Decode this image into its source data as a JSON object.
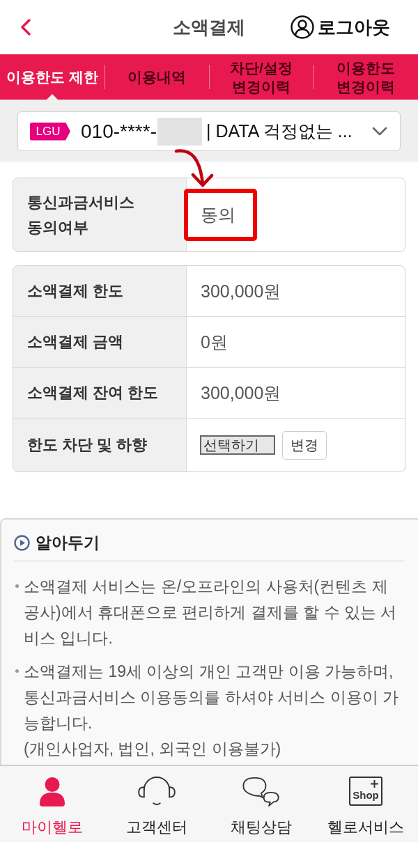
{
  "header": {
    "title": "소액결제",
    "logout": "로그아웃"
  },
  "tabs": [
    {
      "label": "이용한도 제한",
      "selected": true
    },
    {
      "label": "이용내역",
      "selected": false
    },
    {
      "label": "차단/설정 변경이력",
      "selected": false
    },
    {
      "label": "이용한도 변경이력",
      "selected": false
    }
  ],
  "account": {
    "carrier": "LGU",
    "number": "010-****-",
    "number_redacted": true,
    "plan": "| DATA 걱정없는 ..."
  },
  "consent": {
    "label": "통신과금서비스 동의여부",
    "value": "동의",
    "annotated": true
  },
  "limits": [
    {
      "kind": "text",
      "label": "소액결제 한도",
      "value": "300,000원"
    },
    {
      "kind": "text",
      "label": "소액결제 금액",
      "value": "0원"
    },
    {
      "kind": "text",
      "label": "소액결제 잔여 한도",
      "value": "300,000원"
    },
    {
      "kind": "select",
      "label": "한도 차단 및 하향",
      "value": "선택하기",
      "button": "변경"
    }
  ],
  "notes": {
    "title": "알아두기",
    "items": [
      {
        "text": "소액결제 서비스는 온/오프라인의 사용처(컨텐츠 제공사)에서 휴대폰으로 편리하게 결제를 할 수 있는 서비스 입니다."
      },
      {
        "text": "소액결제는 19세 이상의 개인 고객만 이용 가능하며, 통신과금서비스 이용동의를 하셔야 서비스 이용이 가능합니다.",
        "note": "(개인사업자, 법인, 외국인 이용불가)"
      }
    ]
  },
  "nav": [
    {
      "kind": "person",
      "label": "마이헬로",
      "selected": true
    },
    {
      "kind": "headset",
      "label": "고객센터",
      "selected": false
    },
    {
      "kind": "chat",
      "label": "채팅상담",
      "selected": false
    },
    {
      "kind": "shop",
      "label": "헬로서비스",
      "selected": false,
      "icon_text": "Shop"
    }
  ]
}
